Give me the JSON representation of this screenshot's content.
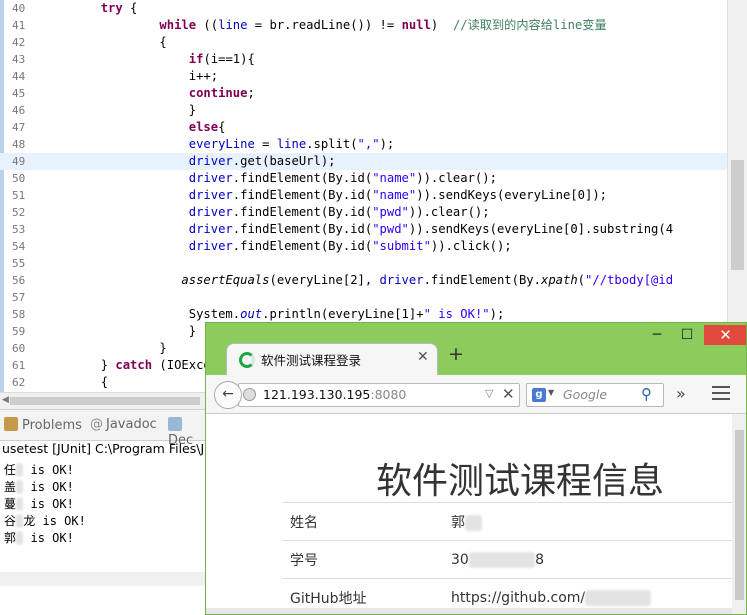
{
  "editor": {
    "lines": [
      {
        "num": "40",
        "tokens": [
          {
            "t": "        "
          },
          {
            "t": "try",
            "c": "kw"
          },
          {
            "t": " {"
          }
        ]
      },
      {
        "num": "41",
        "tokens": [
          {
            "t": "                "
          },
          {
            "t": "while",
            "c": "kw"
          },
          {
            "t": " (("
          },
          {
            "t": "line",
            "c": "fld"
          },
          {
            "t": " = br.readLine()) != "
          },
          {
            "t": "null",
            "c": "kw"
          },
          {
            "t": ")  "
          },
          {
            "t": "//读取到的内容给line变量",
            "c": "cmt"
          }
        ]
      },
      {
        "num": "42",
        "tokens": [
          {
            "t": "                {"
          }
        ]
      },
      {
        "num": "43",
        "tokens": [
          {
            "t": "                    "
          },
          {
            "t": "if",
            "c": "kw"
          },
          {
            "t": "(i==1){"
          }
        ]
      },
      {
        "num": "44",
        "tokens": [
          {
            "t": "                    i++;"
          }
        ]
      },
      {
        "num": "45",
        "tokens": [
          {
            "t": "                    "
          },
          {
            "t": "continue",
            "c": "kw"
          },
          {
            "t": ";"
          }
        ]
      },
      {
        "num": "46",
        "tokens": [
          {
            "t": "                    }"
          }
        ]
      },
      {
        "num": "47",
        "tokens": [
          {
            "t": "                    "
          },
          {
            "t": "else",
            "c": "kw"
          },
          {
            "t": "{"
          }
        ]
      },
      {
        "num": "48",
        "tokens": [
          {
            "t": "                    "
          },
          {
            "t": "everyLine",
            "c": "fld"
          },
          {
            "t": " = "
          },
          {
            "t": "line",
            "c": "fld"
          },
          {
            "t": ".split("
          },
          {
            "t": "\",\"",
            "c": "str"
          },
          {
            "t": ");"
          }
        ]
      },
      {
        "num": "49",
        "tokens": [
          {
            "t": "                    "
          },
          {
            "t": "driver",
            "c": "fld"
          },
          {
            "t": ".get(baseUrl);"
          }
        ],
        "highlight": true
      },
      {
        "num": "50",
        "tokens": [
          {
            "t": "                    "
          },
          {
            "t": "driver",
            "c": "fld"
          },
          {
            "t": ".findElement(By.id("
          },
          {
            "t": "\"name\"",
            "c": "str"
          },
          {
            "t": ")).clear();"
          }
        ]
      },
      {
        "num": "51",
        "tokens": [
          {
            "t": "                    "
          },
          {
            "t": "driver",
            "c": "fld"
          },
          {
            "t": ".findElement(By.id("
          },
          {
            "t": "\"name\"",
            "c": "str"
          },
          {
            "t": ")).sendKeys(everyLine[0]);"
          }
        ]
      },
      {
        "num": "52",
        "tokens": [
          {
            "t": "                    "
          },
          {
            "t": "driver",
            "c": "fld"
          },
          {
            "t": ".findElement(By.id("
          },
          {
            "t": "\"pwd\"",
            "c": "str"
          },
          {
            "t": ")).clear();"
          }
        ]
      },
      {
        "num": "53",
        "tokens": [
          {
            "t": "                    "
          },
          {
            "t": "driver",
            "c": "fld"
          },
          {
            "t": ".findElement(By.id("
          },
          {
            "t": "\"pwd\"",
            "c": "str"
          },
          {
            "t": ")).sendKeys(everyLine[0].substring(4"
          }
        ]
      },
      {
        "num": "54",
        "tokens": [
          {
            "t": "                    "
          },
          {
            "t": "driver",
            "c": "fld"
          },
          {
            "t": ".findElement(By.id("
          },
          {
            "t": "\"submit\"",
            "c": "str"
          },
          {
            "t": ")).click();"
          }
        ]
      },
      {
        "num": "55",
        "tokens": [
          {
            "t": ""
          }
        ]
      },
      {
        "num": "56",
        "tokens": [
          {
            "t": "                   "
          },
          {
            "t": "assertEquals",
            "c": "it"
          },
          {
            "t": "(everyLine[2], "
          },
          {
            "t": "driver",
            "c": "fld"
          },
          {
            "t": ".findElement(By."
          },
          {
            "t": "xpath",
            "c": "it"
          },
          {
            "t": "("
          },
          {
            "t": "\"//tbody[@id",
            "c": "str"
          }
        ]
      },
      {
        "num": "57",
        "tokens": [
          {
            "t": ""
          }
        ]
      },
      {
        "num": "58",
        "tokens": [
          {
            "t": "                    System."
          },
          {
            "t": "out",
            "c": "fld-it"
          },
          {
            "t": ".println(everyLine[1]+"
          },
          {
            "t": "\" is OK!\"",
            "c": "str"
          },
          {
            "t": ");"
          }
        ]
      },
      {
        "num": "59",
        "tokens": [
          {
            "t": "                    }"
          }
        ]
      },
      {
        "num": "60",
        "tokens": [
          {
            "t": "                }"
          }
        ]
      },
      {
        "num": "61",
        "tokens": [
          {
            "t": "        } "
          },
          {
            "t": "catch",
            "c": "kw"
          },
          {
            "t": " (IOException e) {"
          }
        ]
      },
      {
        "num": "62",
        "tokens": [
          {
            "t": "        {"
          }
        ]
      }
    ]
  },
  "console": {
    "tabs": [
      {
        "label": "Problems",
        "color": "#c79a4a"
      },
      {
        "label": "Javadoc",
        "color": "#8aa0c8"
      },
      {
        "label": "Dec",
        "color": "#9bb7d6"
      }
    ],
    "title": "usetest [JUnit] C:\\Program Files\\Jav",
    "lines": [
      {
        "prefix": "任",
        "suffix": " is OK!"
      },
      {
        "prefix": "盖",
        "suffix": " is OK!"
      },
      {
        "prefix": "蔓",
        "suffix": " is OK!"
      },
      {
        "prefix": "谷",
        "suffix": "龙 is OK!"
      },
      {
        "prefix": "郭",
        "suffix": " is OK!"
      }
    ]
  },
  "browser": {
    "tab_title": "软件测试课程登录",
    "url_host": "121.193.130.195",
    "url_port": ":8080",
    "search_placeholder": "Google",
    "page_title": "软件测试课程信息",
    "rows": [
      {
        "label": "姓名",
        "value": "郭"
      },
      {
        "label": "学号",
        "value": "30",
        "value_tail": "8"
      },
      {
        "label": "GitHub地址",
        "value": "https://github.com/"
      }
    ],
    "colors": {
      "frame": "#8ccc5d",
      "close": "#e04a3c"
    }
  }
}
